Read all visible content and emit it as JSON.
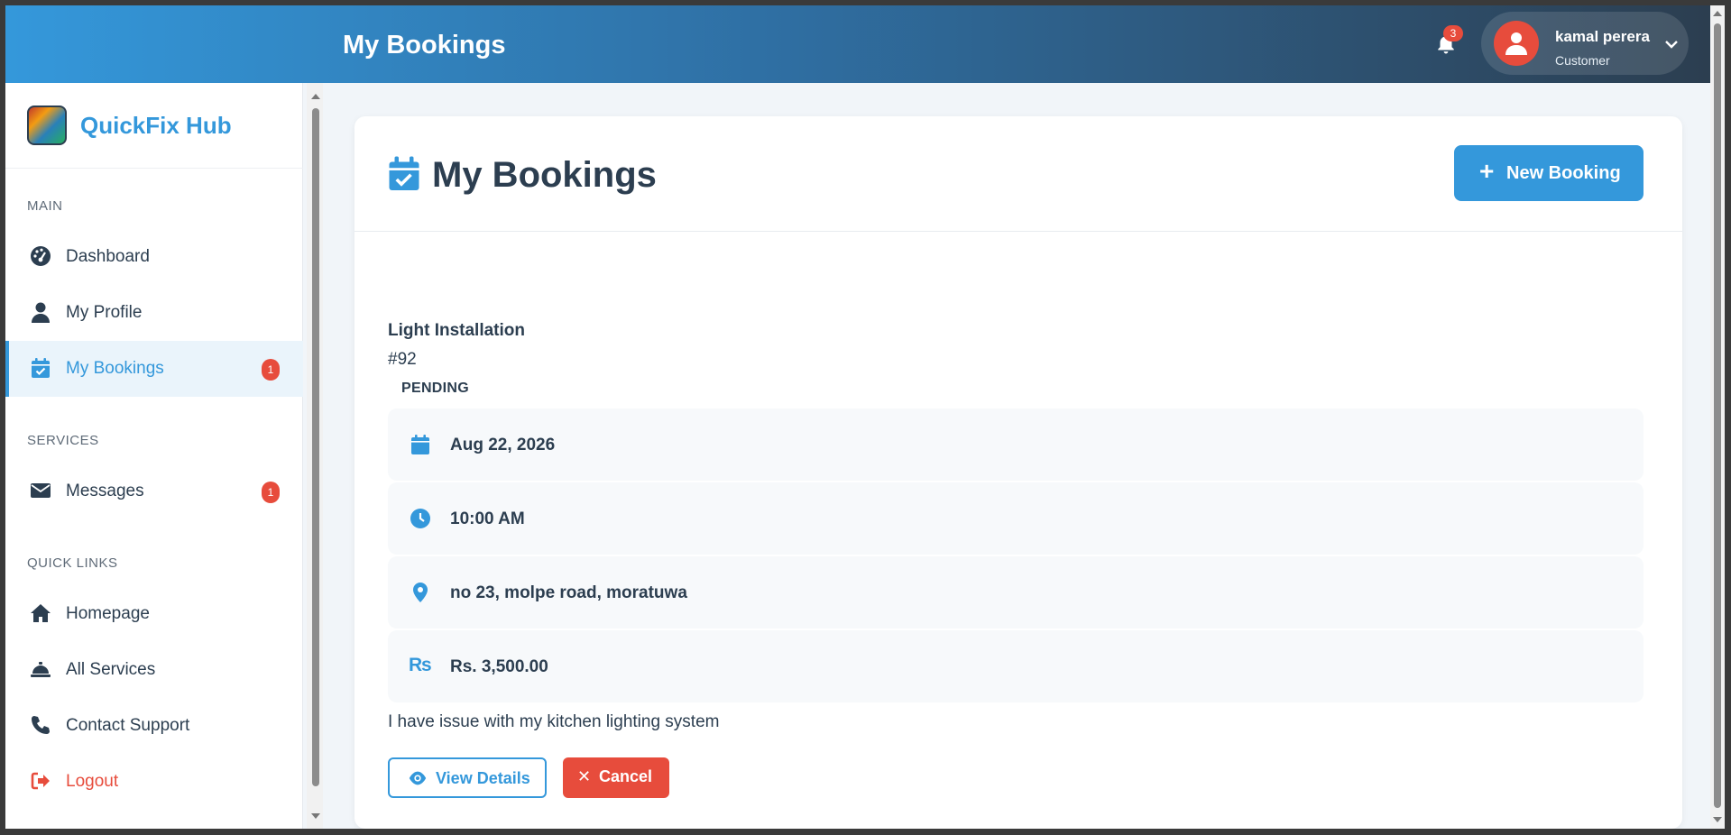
{
  "header": {
    "title": "My Bookings",
    "notifications_count": "3",
    "user": {
      "name": "kamal perera",
      "role": "Customer"
    }
  },
  "sidebar": {
    "brand": "QuickFix Hub",
    "sections": {
      "main": "MAIN",
      "services": "SERVICES",
      "quick_links": "QUICK LINKS"
    },
    "items": [
      {
        "label": "Dashboard",
        "icon": "dashboard-icon"
      },
      {
        "label": "My Profile",
        "icon": "user-icon"
      },
      {
        "label": "My Bookings",
        "icon": "calendar-check-icon",
        "badge": "1",
        "active": true
      },
      {
        "label": "Messages",
        "icon": "envelope-icon",
        "badge": "1"
      },
      {
        "label": "Homepage",
        "icon": "home-icon"
      },
      {
        "label": "All Services",
        "icon": "concierge-bell-icon"
      },
      {
        "label": "Contact Support",
        "icon": "phone-icon"
      },
      {
        "label": "Logout",
        "icon": "logout-icon"
      }
    ]
  },
  "main": {
    "title": "My Bookings",
    "new_booking_label": "New Booking",
    "booking": {
      "service": "Light Installation",
      "id": "#92",
      "status": "PENDING",
      "date": "Aug 22, 2026",
      "time": "10:00 AM",
      "address": "no 23, molpe road, moratuwa",
      "currency_symbol": "₨",
      "price": "Rs. 3,500.00",
      "description": "I have issue with my kitchen lighting system",
      "view_label": "View Details",
      "cancel_label": "Cancel"
    }
  },
  "colors": {
    "primary": "#3498db",
    "dark": "#2c3e50",
    "danger": "#e74c3c",
    "active_bg": "#eaf4fb"
  }
}
